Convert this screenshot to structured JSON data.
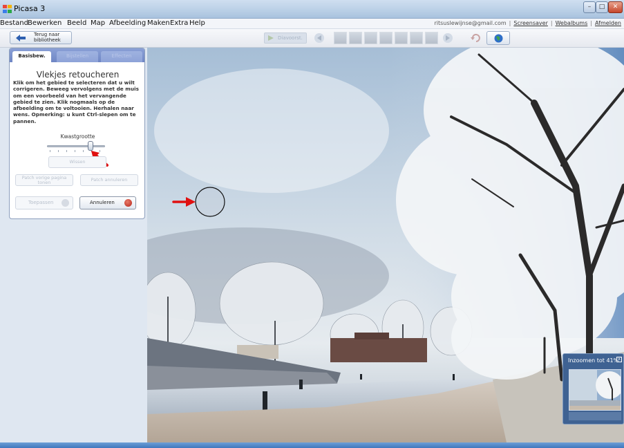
{
  "window": {
    "title": "Picasa 3",
    "buttons": [
      "–",
      "□",
      "✕"
    ]
  },
  "menubar": {
    "items": [
      "Bestand",
      "Bewerken",
      "Beeld",
      "Map",
      "Afbeelding",
      "Maken",
      "Extra",
      "Help"
    ],
    "account_email": "ritsuslewijnse@gmail.com",
    "links": [
      "Screensaver",
      "Webalbums",
      "Afmelden"
    ]
  },
  "toolbar": {
    "back_label": "Terug naar bibliotheek",
    "slideshow_label": "Diavoorst."
  },
  "edit_panel": {
    "tabs": [
      "Basisbew.",
      "Bijstellen",
      "Effecten"
    ],
    "title": "Vlekjes retoucheren",
    "description": "Klik om het gebied te selecteren dat u wilt corrigeren. Beweeg vervolgens met de muis om een voorbeeld van het vervangende gebied te zien. Klik nogmaals op de afbeelding om te voltooien. Herhalen naar wens. Opmerking: u kunt Ctrl-slepen om te pannen.",
    "brush_label": "Kwastgrootte",
    "brush_size": 0.75,
    "wissen_label": "Wissen",
    "patch_prev_label": "Patch vorige pagina tonen",
    "patch_next_label": "Patch annuleren",
    "apply_label": "Toepassen",
    "cancel_label": "Annuleren"
  },
  "zoom": {
    "label": "Inzoomen tot 41%",
    "close": "x"
  },
  "colors": {
    "title_bar": "#b9cfe6",
    "panel_bg": "#dfe7f1",
    "tab_bar": "#7b91cc",
    "annotation_red": "#e01010",
    "status_bar": "#4a84c6",
    "zoom_panel": "#3f6292"
  },
  "icons": [
    "picasa-app-icon",
    "back-arrow-icon",
    "play-icon",
    "prev-icon",
    "next-icon",
    "undo-icon",
    "globe-icon",
    "checkmark-icon",
    "cancel-icon"
  ]
}
